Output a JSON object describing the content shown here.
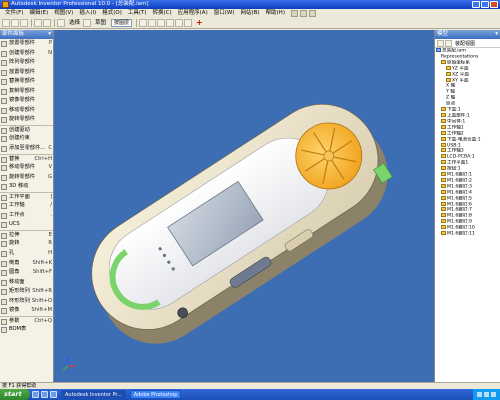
{
  "window": {
    "title": "Autodesk Inventor Professional 10.0 - [总装配.iam]"
  },
  "menubar": {
    "items": [
      "文件(F)",
      "编辑(E)",
      "视图(V)",
      "插入(I)",
      "格式(O)",
      "工具(T)",
      "转换(C)",
      "应用程序(A)",
      "窗口(W)",
      "网站(B)",
      "帮助(H)"
    ]
  },
  "toolbar": {
    "select_label": "选择",
    "sketch_label": "草图",
    "style_value": "按图层"
  },
  "left_panel": {
    "title": "部件面板",
    "items": [
      {
        "label": "放置零部件",
        "shortcut": "P"
      },
      {
        "label": "创建零部件",
        "shortcut": "N"
      },
      {
        "label": "阵列零部件",
        "shortcut": ""
      },
      {
        "label": "放置零部件",
        "shortcut": ""
      },
      {
        "label": "替换零部件",
        "shortcut": ""
      },
      {
        "label": "复制零部件",
        "shortcut": ""
      },
      {
        "label": "镜像零部件",
        "shortcut": ""
      },
      {
        "label": "移动零部件",
        "shortcut": ""
      },
      {
        "label": "旋转零部件",
        "shortcut": ""
      },
      {
        "label": "创建驱动",
        "shortcut": ""
      },
      {
        "label": "创建约束",
        "shortcut": ""
      },
      {
        "label": "添加至零部件...",
        "shortcut": "C"
      },
      {
        "label": "替换",
        "shortcut": "Ctrl+H"
      },
      {
        "label": "移动零部件",
        "shortcut": "V"
      },
      {
        "label": "旋转零部件",
        "shortcut": "G"
      },
      {
        "label": "3D 移动",
        "shortcut": ""
      },
      {
        "label": "工作平面",
        "shortcut": "]"
      },
      {
        "label": "工作轴",
        "shortcut": "/"
      },
      {
        "label": "工作点",
        "shortcut": "."
      },
      {
        "label": "UCS",
        "shortcut": ""
      },
      {
        "label": "拉伸",
        "shortcut": "E"
      },
      {
        "label": "旋转",
        "shortcut": "R"
      },
      {
        "label": "孔",
        "shortcut": "H"
      },
      {
        "label": "倒角",
        "shortcut": "Shift+K"
      },
      {
        "label": "圆角",
        "shortcut": "Shift+F"
      },
      {
        "label": "移动面",
        "shortcut": ""
      },
      {
        "label": "矩形阵列",
        "shortcut": "Shift+R"
      },
      {
        "label": "环形阵列",
        "shortcut": "Shift+O"
      },
      {
        "label": "镜像",
        "shortcut": "Shift+M"
      },
      {
        "label": "参数",
        "shortcut": "Ctrl+Q"
      },
      {
        "label": "BOM表",
        "shortcut": ""
      }
    ]
  },
  "right_panel": {
    "title": "模型",
    "toolbar_label": "装配视图",
    "tree": [
      {
        "label": "总装配.iam",
        "indent": 0,
        "icon": "blue"
      },
      {
        "label": "Representations",
        "indent": 1,
        "icon": "none"
      },
      {
        "label": "原始坐标系",
        "indent": 1,
        "icon": "yellow"
      },
      {
        "label": "YZ 平面",
        "indent": 2,
        "icon": "yellow"
      },
      {
        "label": "XZ 平面",
        "indent": 2,
        "icon": "yellow"
      },
      {
        "label": "XY 平面",
        "indent": 2,
        "icon": "yellow"
      },
      {
        "label": "X 轴",
        "indent": 2,
        "icon": "none"
      },
      {
        "label": "Y 轴",
        "indent": 2,
        "icon": "none"
      },
      {
        "label": "Z 轴",
        "indent": 2,
        "icon": "none"
      },
      {
        "label": "原点",
        "indent": 2,
        "icon": "none"
      },
      {
        "label": "下盖:1",
        "indent": 1,
        "icon": "yellow"
      },
      {
        "label": "上盖部件:1",
        "indent": 1,
        "icon": "yellow"
      },
      {
        "label": "中间体:1",
        "indent": 1,
        "icon": "yellow"
      },
      {
        "label": "工作轴1",
        "indent": 1,
        "icon": "yellow"
      },
      {
        "label": "工作轴2",
        "indent": 1,
        "icon": "yellow"
      },
      {
        "label": "下盖-电池仓盖:1",
        "indent": 1,
        "icon": "yellow"
      },
      {
        "label": "USB:1",
        "indent": 1,
        "icon": "yellow"
      },
      {
        "label": "工作轴3",
        "indent": 1,
        "icon": "yellow"
      },
      {
        "label": "LCD-PCBA:1",
        "indent": 1,
        "icon": "yellow"
      },
      {
        "label": "工作平面1",
        "indent": 1,
        "icon": "yellow"
      },
      {
        "label": "按钮:1",
        "indent": 1,
        "icon": "yellow"
      },
      {
        "label": "M1.6螺钉:1",
        "indent": 1,
        "icon": "yellow"
      },
      {
        "label": "M1.6螺钉:2",
        "indent": 1,
        "icon": "yellow"
      },
      {
        "label": "M1.6螺钉:3",
        "indent": 1,
        "icon": "yellow"
      },
      {
        "label": "M1.6螺钉:4",
        "indent": 1,
        "icon": "yellow"
      },
      {
        "label": "M1.6螺钉:5",
        "indent": 1,
        "icon": "yellow"
      },
      {
        "label": "M1.6螺钉:6",
        "indent": 1,
        "icon": "yellow"
      },
      {
        "label": "M1.6螺钉:7",
        "indent": 1,
        "icon": "yellow"
      },
      {
        "label": "M1.6螺钉:8",
        "indent": 1,
        "icon": "yellow"
      },
      {
        "label": "M1.6螺钉:9",
        "indent": 1,
        "icon": "yellow"
      },
      {
        "label": "M1.6螺钉:10",
        "indent": 1,
        "icon": "yellow"
      },
      {
        "label": "M1.6螺钉:11",
        "indent": 1,
        "icon": "yellow"
      }
    ]
  },
  "statusbar": {
    "text": "按 F1 获得帮助"
  },
  "taskbar": {
    "start_label": "start",
    "tasks": [
      "Autodesk Inventor Pr...",
      "Adobe Photoshop"
    ],
    "clock": ""
  }
}
